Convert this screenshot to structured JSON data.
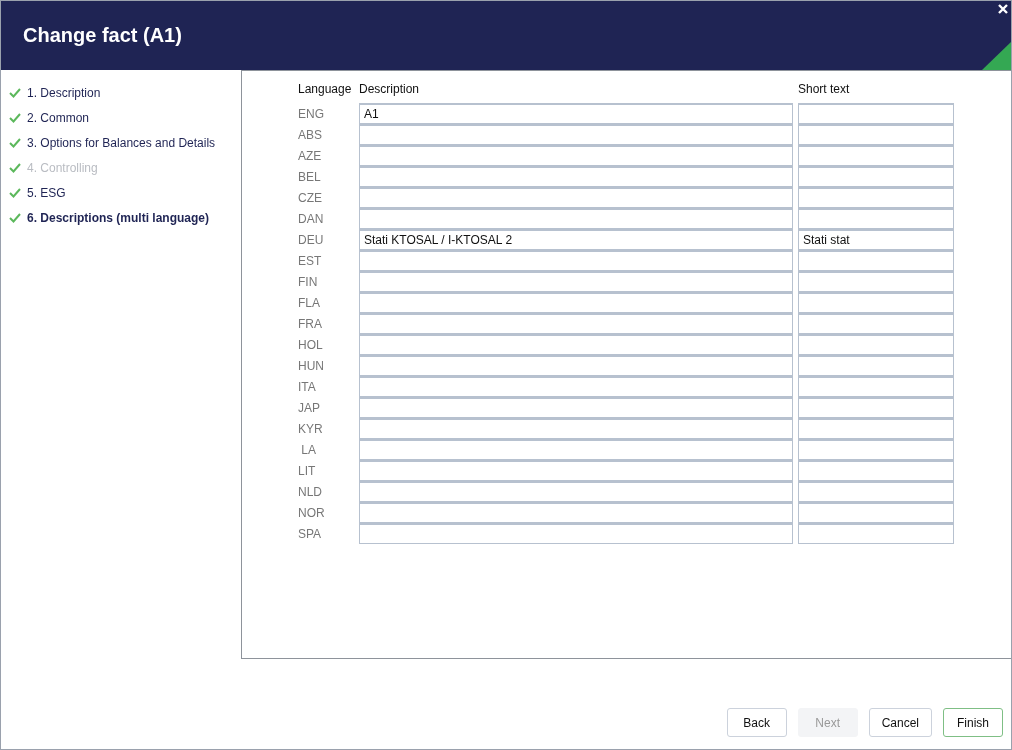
{
  "window": {
    "title": "Change fact (A1)"
  },
  "steps": [
    {
      "label": "1. Description",
      "completed": true,
      "disabled": false,
      "selected": false
    },
    {
      "label": "2. Common",
      "completed": true,
      "disabled": false,
      "selected": false
    },
    {
      "label": "3. Options for Balances and Details",
      "completed": true,
      "disabled": false,
      "selected": false
    },
    {
      "label": "4. Controlling",
      "completed": true,
      "disabled": true,
      "selected": false
    },
    {
      "label": "5. ESG",
      "completed": true,
      "disabled": false,
      "selected": false
    },
    {
      "label": "6. Descriptions (multi language)",
      "completed": true,
      "disabled": false,
      "selected": true
    }
  ],
  "table": {
    "columns": [
      "Language",
      "Description",
      "Short text"
    ],
    "rows": [
      {
        "language": "ENG",
        "description": "A1"
      },
      {
        "language": "ABS"
      },
      {
        "language": "AZE"
      },
      {
        "language": "BEL"
      },
      {
        "language": "CZE"
      },
      {
        "language": "DAN"
      },
      {
        "language": "DEU",
        "description": "Stati KTOSAL / I-KTOSAL 2",
        "short_text": "Stati stat"
      },
      {
        "language": "EST"
      },
      {
        "language": "FIN"
      },
      {
        "language": "FLA"
      },
      {
        "language": "FRA"
      },
      {
        "language": "HOL"
      },
      {
        "language": "HUN"
      },
      {
        "language": "ITA"
      },
      {
        "language": "JAP"
      },
      {
        "language": "KYR"
      },
      {
        "language": " LA"
      },
      {
        "language": "LIT"
      },
      {
        "language": "NLD"
      },
      {
        "language": "NOR"
      },
      {
        "language": "SPA"
      }
    ]
  },
  "buttons": [
    {
      "label": "Back",
      "disabled": false,
      "primary": false
    },
    {
      "label": "Next",
      "disabled": true,
      "primary": false
    },
    {
      "label": "Cancel",
      "disabled": false,
      "primary": false
    },
    {
      "label": "Finish",
      "disabled": false,
      "primary": true
    }
  ]
}
